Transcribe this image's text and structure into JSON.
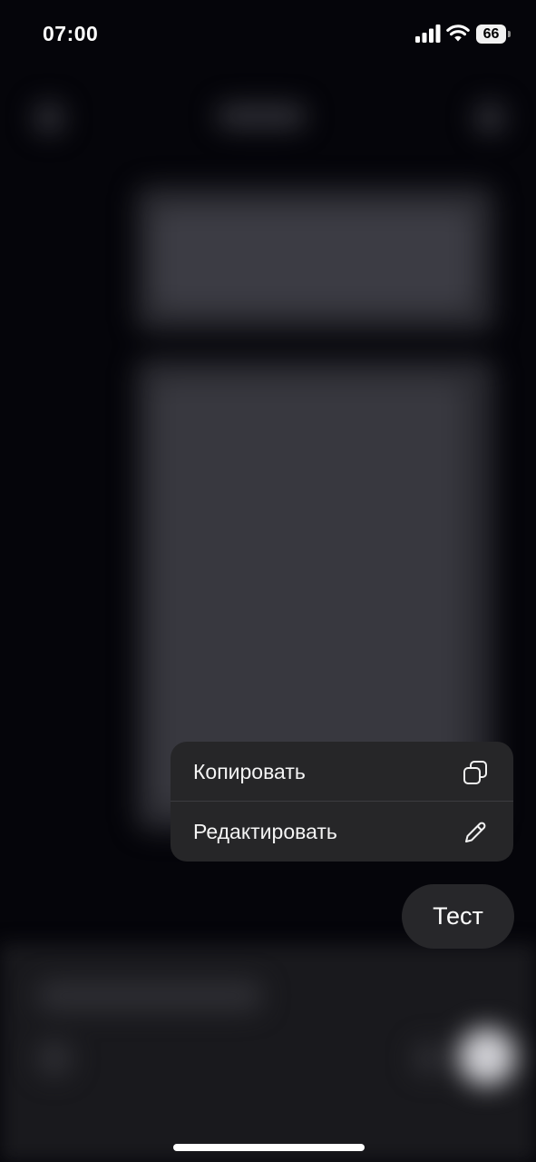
{
  "status_bar": {
    "time": "07:00",
    "battery_level": "66",
    "icons": [
      "cellular-signal-icon",
      "wifi-icon",
      "battery-icon"
    ]
  },
  "context_menu": {
    "items": [
      {
        "label": "Копировать",
        "icon": "copy-icon"
      },
      {
        "label": "Редактировать",
        "icon": "pencil-icon"
      }
    ]
  },
  "message": {
    "text": "Тест"
  },
  "colors": {
    "background": "#05050a",
    "menu_background": "#262628",
    "bubble_background": "#27272a",
    "text": "#ffffff"
  }
}
